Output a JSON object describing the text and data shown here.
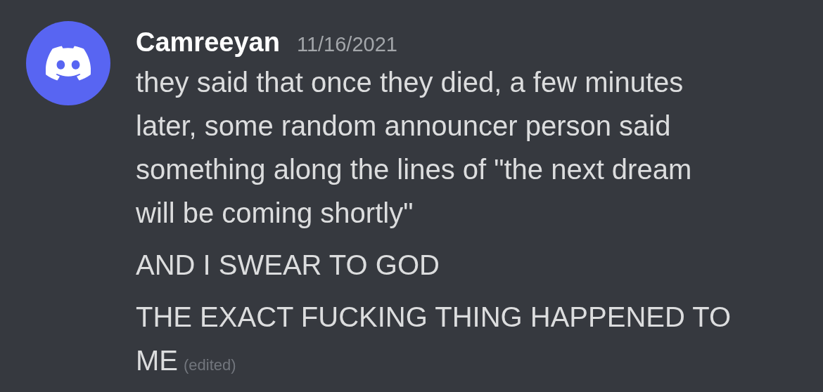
{
  "message_group": {
    "author": "Camreeyan",
    "timestamp": "11/16/2021",
    "messages": [
      {
        "text": "they said that once they died, a few minutes later, some random announcer person said something along the lines of \"the next dream will be coming shortly\"",
        "edited": false
      },
      {
        "text": "AND I SWEAR TO GOD",
        "edited": false
      },
      {
        "text": "THE EXACT FUCKING THING HAPPENED TO ME",
        "edited": true,
        "edited_label": "(edited)"
      }
    ]
  }
}
